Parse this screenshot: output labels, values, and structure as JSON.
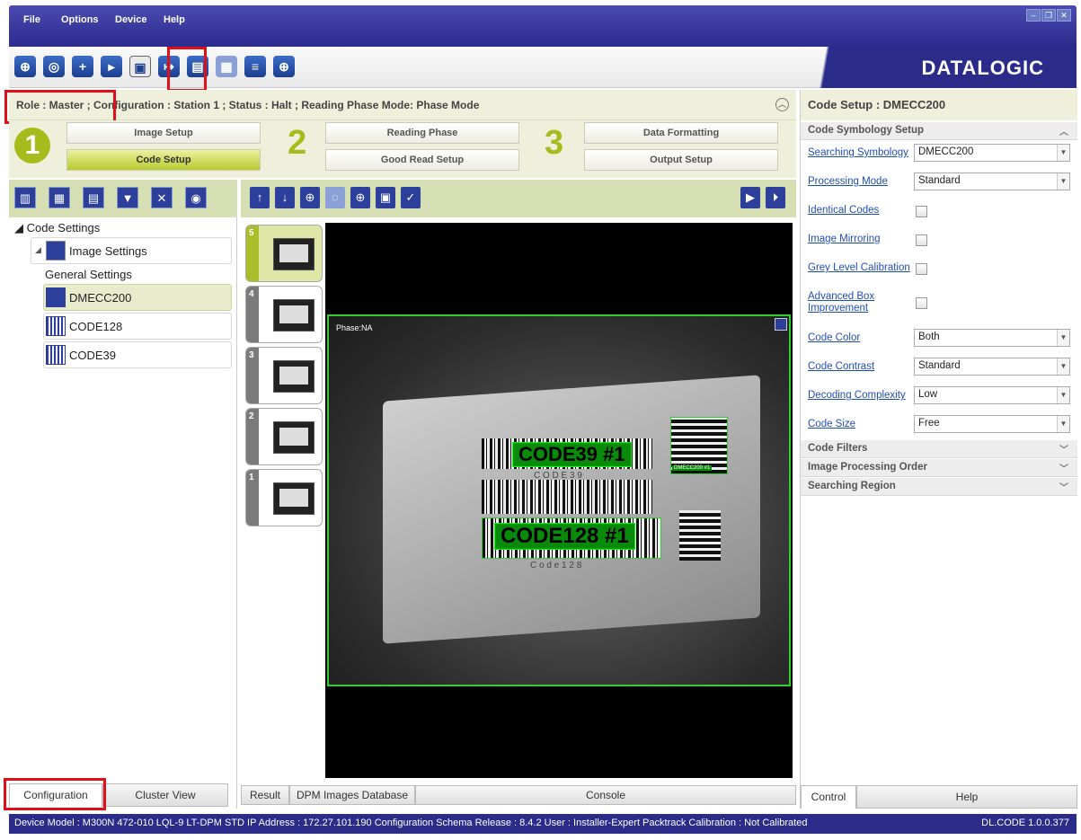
{
  "menu": [
    "File",
    "Options",
    "Device",
    "Help"
  ],
  "logo": "DATALOGIC",
  "window_controls": [
    "minimize-icon",
    "restore-icon",
    "close-icon"
  ],
  "toolbar_icons": [
    "target-icon",
    "gear-camera-icon",
    "add-image-icon",
    "get-image-icon",
    "save-image-icon",
    "export-icon",
    "send-icon",
    "image-settings-icon",
    "compare-icon",
    "crosshair-icon"
  ],
  "rolebar": {
    "text": "Role : Master ; Configuration : Station 1 ; Status : Halt ; Reading Phase Mode: Phase Mode"
  },
  "steps": {
    "n1": "1",
    "n2": "2",
    "n3": "3",
    "image_setup": "Image Setup",
    "code_setup": "Code Setup",
    "reading_phase": "Reading Phase",
    "good_read_setup": "Good Read Setup",
    "data_formatting": "Data Formatting",
    "output_setup": "Output Setup"
  },
  "tree": {
    "root": "Code Settings",
    "image_settings": "Image Settings",
    "general_settings": "General Settings",
    "codes": [
      "DMECC200",
      "CODE128",
      "CODE39"
    ]
  },
  "thumbnails": [
    "5",
    "4",
    "3",
    "2",
    "1"
  ],
  "viewer": {
    "phase": "Phase:NA",
    "label_code39": "CODE39  #1",
    "label_code128": "CODE128  #1",
    "label_dm": "DMECC200 #1",
    "sub_code39": "C O D E  3 9",
    "sub_code128": "C o d e   1 2 8"
  },
  "left_tabs": [
    "Configuration",
    "Cluster View"
  ],
  "mid_tabs": [
    "Result",
    "DPM Images Database",
    "Console"
  ],
  "right_tabs": [
    "Control",
    "Help"
  ],
  "right": {
    "title": "Code Setup : DMECC200",
    "section_symbology": "Code Symbology Setup",
    "searching_symbology": {
      "label": "Searching Symbology",
      "value": "DMECC200"
    },
    "processing_mode": {
      "label": "Processing Mode",
      "value": "Standard"
    },
    "identical_codes": "Identical Codes",
    "image_mirroring": "Image Mirroring",
    "grey_level": "Grey Level Calibration",
    "advanced_box_1": "Advanced Box",
    "advanced_box_2": "Improvement",
    "code_color": {
      "label": "Code Color",
      "value": "Both"
    },
    "code_contrast": {
      "label": "Code Contrast",
      "value": "Standard"
    },
    "decoding_complexity": {
      "label": "Decoding Complexity",
      "value": "Low"
    },
    "code_size": {
      "label": "Code Size",
      "value": "Free"
    },
    "section_filters": "Code Filters",
    "section_processing_order": "Image Processing Order",
    "section_searching_region": "Searching Region"
  },
  "status": {
    "text": "Device Model : M300N  472-010  LQL-9 LT-DPM STD   IP Address :  172.27.101.190   Configuration Schema Release :  8.4.2   User : Installer-Expert   Packtrack Calibration : Not Calibrated",
    "version": "DL.CODE 1.0.0.377"
  },
  "colors": {
    "menubar": "#2c2c8e",
    "accent_green": "#a5bd1c",
    "highlight_red": "#e0101a",
    "detect_green": "#2ed02e"
  }
}
